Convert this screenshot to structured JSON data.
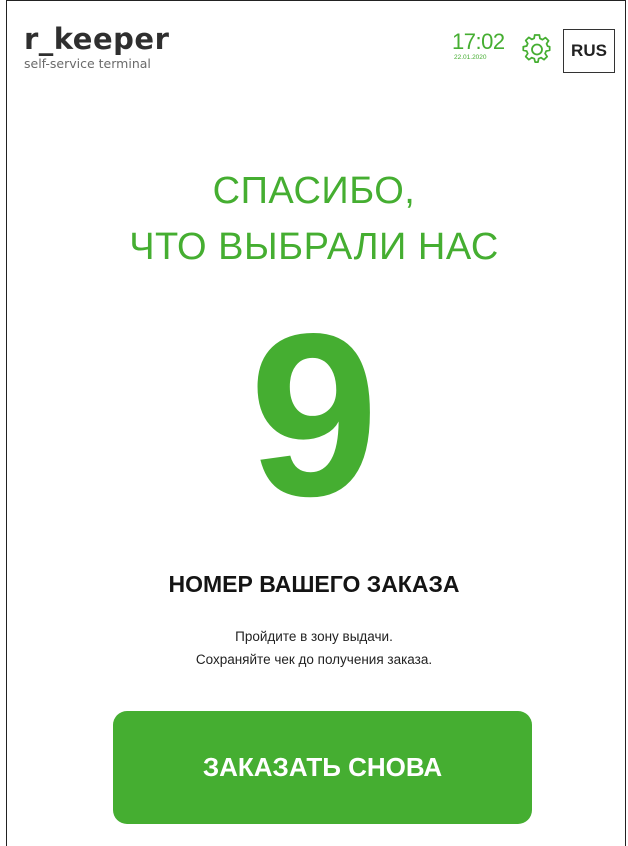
{
  "header": {
    "logo_main": "r_keeper",
    "logo_sub": "self-service terminal",
    "time": "17:02",
    "date": "22.01.2020",
    "language": "RUS"
  },
  "icons": {
    "settings": "gear-icon"
  },
  "colors": {
    "accent": "#45ae31",
    "text_dark": "#141414"
  },
  "main": {
    "thanks_line1": "СПАСИБО,",
    "thanks_line2": "ЧТО ВЫБРАЛИ НАС",
    "order_number": "9",
    "order_label": "НОМЕР ВАШЕГО ЗАКАЗА",
    "instruction_line1": "Пройдите в зону выдачи.",
    "instruction_line2": "Сохраняйте чек до получения заказа.",
    "order_again_label": "ЗАКАЗАТЬ СНОВА"
  }
}
